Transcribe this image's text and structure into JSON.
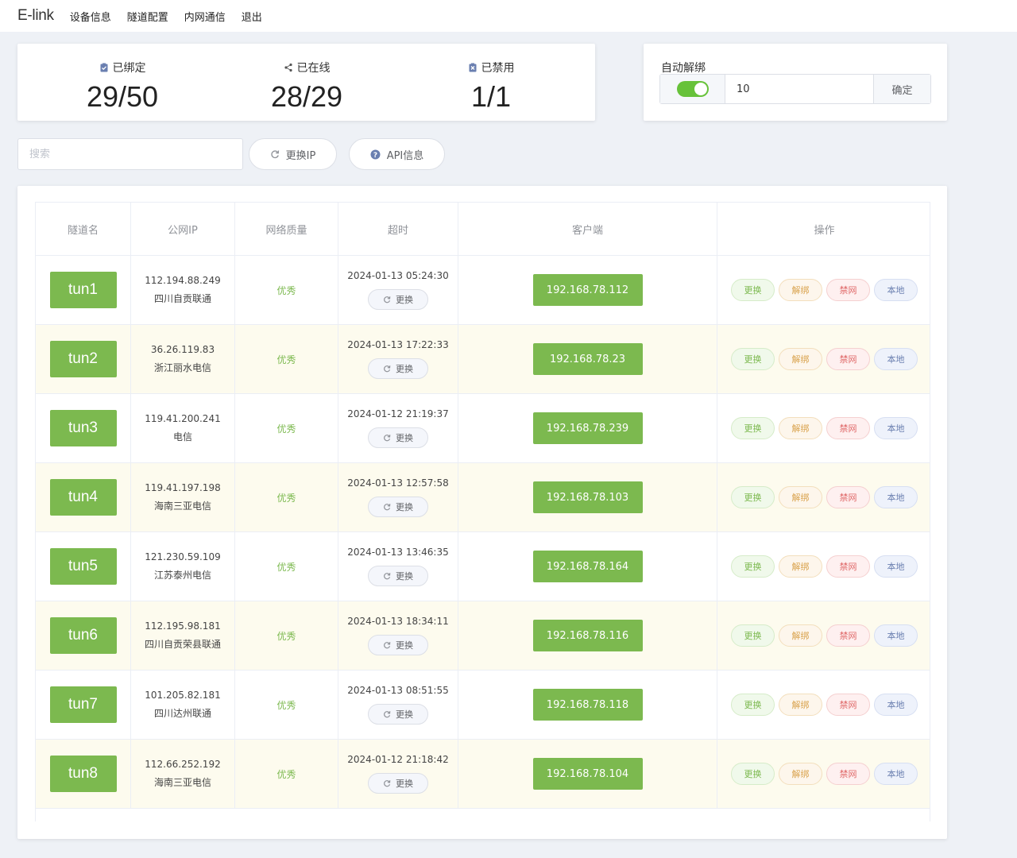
{
  "app": {
    "brand": "E-link"
  },
  "nav": [
    "设备信息",
    "隧道配置",
    "内网通信",
    "退出"
  ],
  "stats": [
    {
      "label": "已绑定",
      "value": "29/50",
      "icon": "clipboard-check-icon"
    },
    {
      "label": "已在线",
      "value": "28/29",
      "icon": "share-icon"
    },
    {
      "label": "已禁用",
      "value": "1/1",
      "icon": "clipboard-x-icon"
    }
  ],
  "auto_unbind": {
    "title": "自动解绑",
    "enabled": true,
    "value": "10",
    "confirm": "确定"
  },
  "search": {
    "placeholder": "搜索"
  },
  "actions": {
    "change_ip": "更换IP",
    "api_info": "API信息"
  },
  "table": {
    "headers": [
      "隧道名",
      "公网IP",
      "网络质量",
      "超时",
      "客户端",
      "操作"
    ],
    "swap_label": "更换",
    "ops": [
      "更换",
      "解绑",
      "禁网",
      "本地"
    ],
    "rows": [
      {
        "name": "tun1",
        "ip": "112.194.88.249",
        "isp": "四川自贡联通",
        "quality": "优秀",
        "timeout": "2024-01-13 05:24:30",
        "client": "192.168.78.112"
      },
      {
        "name": "tun2",
        "ip": "36.26.119.83",
        "isp": "浙江丽水电信",
        "quality": "优秀",
        "timeout": "2024-01-13 17:22:33",
        "client": "192.168.78.23"
      },
      {
        "name": "tun3",
        "ip": "119.41.200.241",
        "isp": "电信",
        "quality": "优秀",
        "timeout": "2024-01-12 21:19:37",
        "client": "192.168.78.239"
      },
      {
        "name": "tun4",
        "ip": "119.41.197.198",
        "isp": "海南三亚电信",
        "quality": "优秀",
        "timeout": "2024-01-13 12:57:58",
        "client": "192.168.78.103"
      },
      {
        "name": "tun5",
        "ip": "121.230.59.109",
        "isp": "江苏泰州电信",
        "quality": "优秀",
        "timeout": "2024-01-13 13:46:35",
        "client": "192.168.78.164"
      },
      {
        "name": "tun6",
        "ip": "112.195.98.181",
        "isp": "四川自贡荣县联通",
        "quality": "优秀",
        "timeout": "2024-01-13 18:34:11",
        "client": "192.168.78.116"
      },
      {
        "name": "tun7",
        "ip": "101.205.82.181",
        "isp": "四川达州联通",
        "quality": "优秀",
        "timeout": "2024-01-13 08:51:55",
        "client": "192.168.78.118"
      },
      {
        "name": "tun8",
        "ip": "112.66.252.192",
        "isp": "海南三亚电信",
        "quality": "优秀",
        "timeout": "2024-01-12 21:18:42",
        "client": "192.168.78.104"
      }
    ]
  },
  "colors": {
    "accent_green": "#7cb94f",
    "switch_on": "#67c23a",
    "row_alt": "#fdfbee"
  }
}
